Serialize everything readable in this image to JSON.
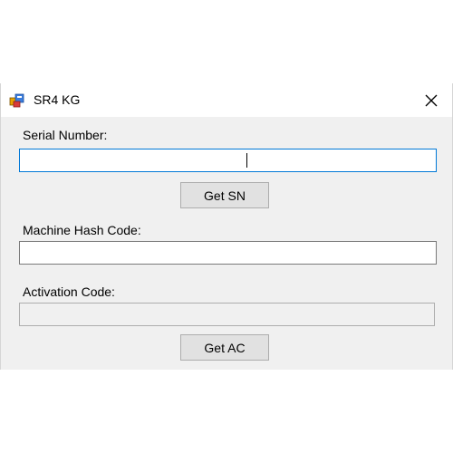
{
  "window": {
    "title": "SR4 KG",
    "close_glyph": "✕",
    "app_icon": "application-icon"
  },
  "form": {
    "serial_number_label": "Serial Number:",
    "serial_number_value": "",
    "get_sn_button": "Get SN",
    "machine_hash_label": "Machine Hash Code:",
    "machine_hash_value": "",
    "activation_code_label": "Activation Code:",
    "activation_code_value": "",
    "get_ac_button": "Get AC"
  },
  "colors": {
    "focus_border": "#0078d7",
    "window_background": "#f0f0f0",
    "button_background": "#e1e1e1"
  }
}
